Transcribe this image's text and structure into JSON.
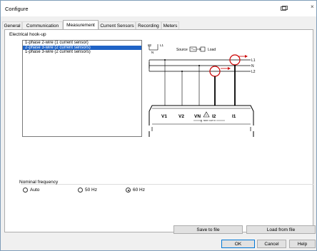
{
  "window": {
    "title": "Configure",
    "restore_icon": "restore-window-icon",
    "close_icon": "close-icon"
  },
  "tabs": [
    {
      "label": "General"
    },
    {
      "label": "Communication"
    },
    {
      "label": "Measurement",
      "active": true
    },
    {
      "label": "Current Sensors"
    },
    {
      "label": "Recording"
    },
    {
      "label": "Meters"
    }
  ],
  "hookup": {
    "label": "Electrical hook-up",
    "options": [
      "1-phase 2-wire (1 current sensor)",
      "2-phase 3-wire (2 current sensors)",
      "1-phase 3-wire (2 current sensors)"
    ],
    "selected_index": 1
  },
  "diagram": {
    "source_label": "Source",
    "load_label": "Load",
    "source_legend_top": "L2",
    "source_legend_right": "L1",
    "source_legend_bottom": "N",
    "lines": [
      "L1",
      "N",
      "L2"
    ],
    "terminals": [
      "V1",
      "V2",
      "VN",
      "I2",
      "I1"
    ],
    "rating": "600V CAT III",
    "accent_color": "#cc0000"
  },
  "frequency": {
    "label": "Nominal frequency",
    "options": [
      {
        "label": "Auto",
        "checked": false
      },
      {
        "label": "50 Hz",
        "checked": false
      },
      {
        "label": "60 Hz",
        "checked": true
      }
    ]
  },
  "file_buttons": {
    "save": "Save to file",
    "load": "Load from file"
  },
  "dialog_buttons": {
    "ok": "OK",
    "cancel": "Cancel",
    "help": "Help"
  }
}
